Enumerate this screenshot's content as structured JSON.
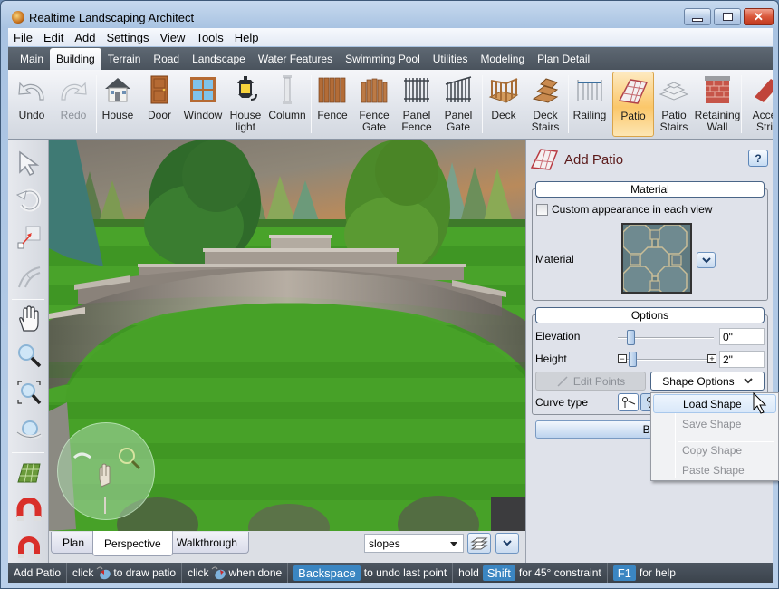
{
  "window": {
    "title": "Realtime Landscaping Architect",
    "controls": {
      "minimize": "minimize",
      "maximize": "maximize",
      "close": "✕"
    }
  },
  "menubar": [
    "File",
    "Edit",
    "Add",
    "Settings",
    "View",
    "Tools",
    "Help"
  ],
  "ribbon_tabs": {
    "items": [
      "Main",
      "Building",
      "Terrain",
      "Road",
      "Landscape",
      "Water Features",
      "Swimming Pool",
      "Utilities",
      "Modeling",
      "Plan Detail"
    ],
    "active": "Building"
  },
  "toolbar": {
    "undo": "Undo",
    "redo": "Redo",
    "house": "House",
    "door": "Door",
    "window": "Window",
    "house_light": "House\nlight",
    "column": "Column",
    "fence": "Fence",
    "fence_gate": "Fence\nGate",
    "panel_fence": "Panel\nFence",
    "panel_gate": "Panel\nGate",
    "deck": "Deck",
    "deck_stairs": "Deck\nStairs",
    "railing": "Railing",
    "patio": "Patio",
    "patio_stairs": "Patio\nStairs",
    "retaining_wall": "Retaining\nWall",
    "accent_strip": "Acce\nStri",
    "active_tool": "Patio",
    "colors": {
      "active_bg": "#fbc76a",
      "active_border": "#d9a44a"
    }
  },
  "left_tools": [
    "select",
    "rotate",
    "resize",
    "curve",
    "pan",
    "zoom",
    "zoom-extents",
    "orbit",
    "grid",
    "snap",
    "snap-options"
  ],
  "view_tabs": {
    "items": [
      "Plan",
      "Perspective",
      "Walkthrough"
    ],
    "active": "Perspective"
  },
  "layer_combo": {
    "value": "slopes"
  },
  "panel": {
    "title": "Add Patio",
    "help_label": "?",
    "material_group": {
      "header": "Material",
      "custom_appearance_label": "Custom appearance in each view",
      "custom_appearance_checked": false,
      "material_label": "Material"
    },
    "options_group": {
      "header": "Options",
      "elevation_label": "Elevation",
      "elevation_value": "0\"",
      "height_label": "Height",
      "height_value": "2\"",
      "edit_points_label": "Edit Points",
      "shape_options_label": "Shape Options",
      "curve_type_label": "Curve type"
    },
    "border_button_label": "Bor"
  },
  "shape_menu": {
    "items": [
      {
        "label": "Load Shape",
        "enabled": true,
        "hover": true
      },
      {
        "label": "Save Shape",
        "enabled": false
      },
      {
        "label": "Copy Shape",
        "enabled": false
      },
      {
        "label": "Paste Shape",
        "enabled": false
      }
    ]
  },
  "statusbar": {
    "mode": "Add Patio",
    "click1": "click",
    "draw": "to draw patio",
    "click2": "click",
    "done": "when done",
    "key_backspace": "Backspace",
    "undo_text": "to undo last point",
    "hold": "hold",
    "key_shift": "Shift",
    "constraint": "for 45° constraint",
    "key_f1": "F1",
    "help": "for help",
    "key_color": "#3b86c2"
  }
}
